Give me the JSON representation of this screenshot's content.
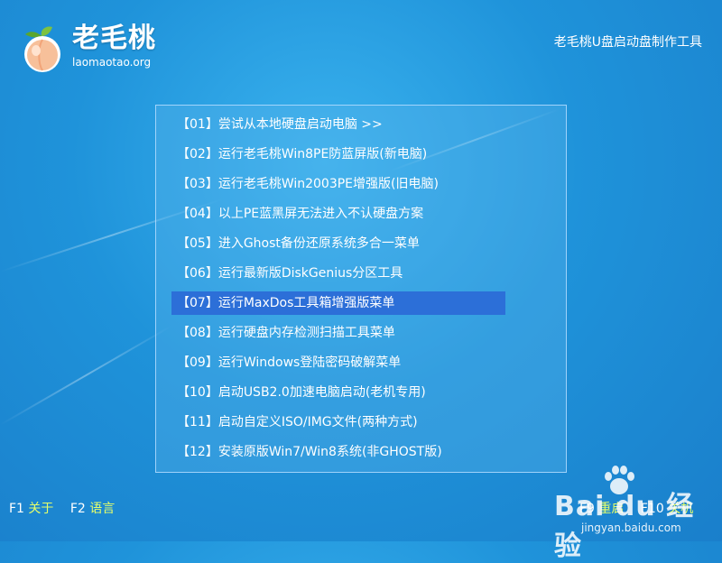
{
  "header": {
    "logo_name": "老毛桃",
    "logo_domain": "laomaotao.org",
    "app_title": "老毛桃U盘启动盘制作工具"
  },
  "menu": {
    "selected_index": 6,
    "items": [
      {
        "label": "【01】尝试从本地硬盘启动电脑 >>"
      },
      {
        "label": "【02】运行老毛桃Win8PE防蓝屏版(新电脑)"
      },
      {
        "label": "【03】运行老毛桃Win2003PE增强版(旧电脑)"
      },
      {
        "label": "【04】以上PE蓝黑屏无法进入不认硬盘方案"
      },
      {
        "label": "【05】进入Ghost备份还原系统多合一菜单"
      },
      {
        "label": "【06】运行最新版DiskGenius分区工具"
      },
      {
        "label": "【07】运行MaxDos工具箱增强版菜单"
      },
      {
        "label": "【08】运行硬盘内存检测扫描工具菜单"
      },
      {
        "label": "【09】运行Windows登陆密码破解菜单"
      },
      {
        "label": "【10】启动USB2.0加速电脑启动(老机专用)"
      },
      {
        "label": "【11】启动自定义ISO/IMG文件(两种方式)"
      },
      {
        "label": "【12】安装原版Win7/Win8系统(非GHOST版)"
      }
    ]
  },
  "hotkeys": {
    "left": [
      {
        "key": "F1",
        "label": "关于"
      },
      {
        "key": "F2",
        "label": "语言"
      }
    ],
    "right": [
      {
        "key": "F9",
        "label": "重启"
      },
      {
        "key": "F10",
        "label": "关机"
      }
    ]
  },
  "watermark": {
    "brand": "Bai du 经验",
    "url": "jingyan.baidu.com"
  },
  "colors": {
    "background": "#1f93da",
    "selected_item": "#2c6fd8",
    "hotkey_label": "#e6ff6a"
  }
}
